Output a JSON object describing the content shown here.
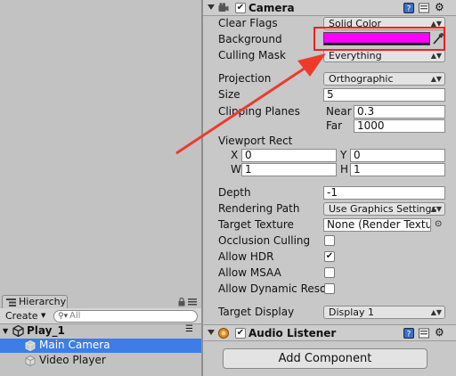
{
  "hierarchy": {
    "tab_label": "Hierarchy",
    "create_label": "Create",
    "search_placeholder": "All",
    "scene_name": "Play_1",
    "items": [
      {
        "label": "Main Camera",
        "selected": true
      },
      {
        "label": "Video Player",
        "selected": false
      }
    ]
  },
  "camera": {
    "title": "Camera",
    "enabled": true,
    "fields": {
      "clear_flags": {
        "label": "Clear Flags",
        "value": "Solid Color"
      },
      "background": {
        "label": "Background",
        "color": "#ff00ff"
      },
      "culling_mask": {
        "label": "Culling Mask",
        "value": "Everything"
      },
      "projection": {
        "label": "Projection",
        "value": "Orthographic"
      },
      "size": {
        "label": "Size",
        "value": "5"
      },
      "clipping_planes": {
        "label": "Clipping Planes",
        "near_label": "Near",
        "near": "0.3",
        "far_label": "Far",
        "far": "1000"
      },
      "viewport_rect": {
        "label": "Viewport Rect",
        "x_label": "X",
        "x": "0",
        "y_label": "Y",
        "y": "0",
        "w_label": "W",
        "w": "1",
        "h_label": "H",
        "h": "1"
      },
      "depth": {
        "label": "Depth",
        "value": "-1"
      },
      "rendering_path": {
        "label": "Rendering Path",
        "value": "Use Graphics Settings"
      },
      "target_texture": {
        "label": "Target Texture",
        "value": "None (Render Textu"
      },
      "occlusion_culling": {
        "label": "Occlusion Culling",
        "checked": false
      },
      "allow_hdr": {
        "label": "Allow HDR",
        "checked": true
      },
      "allow_msaa": {
        "label": "Allow MSAA",
        "checked": false
      },
      "allow_dynamic_res": {
        "label": "Allow Dynamic Reso",
        "checked": false
      },
      "target_display": {
        "label": "Target Display",
        "value": "Display 1"
      }
    }
  },
  "audio_listener": {
    "title": "Audio Listener",
    "enabled": true
  },
  "add_component_label": "Add Component",
  "highlight_color": "#ef1f1f",
  "selection_color": "#3e7de6",
  "icons": [
    "help-icon",
    "preset-icon",
    "gear-icon",
    "eyedropper-icon",
    "lock-icon",
    "menu-icon",
    "search-icon",
    "unity-logo-icon",
    "gameobject-icon",
    "camera-icon",
    "audio-listener-icon",
    "chevron-down-icon"
  ]
}
